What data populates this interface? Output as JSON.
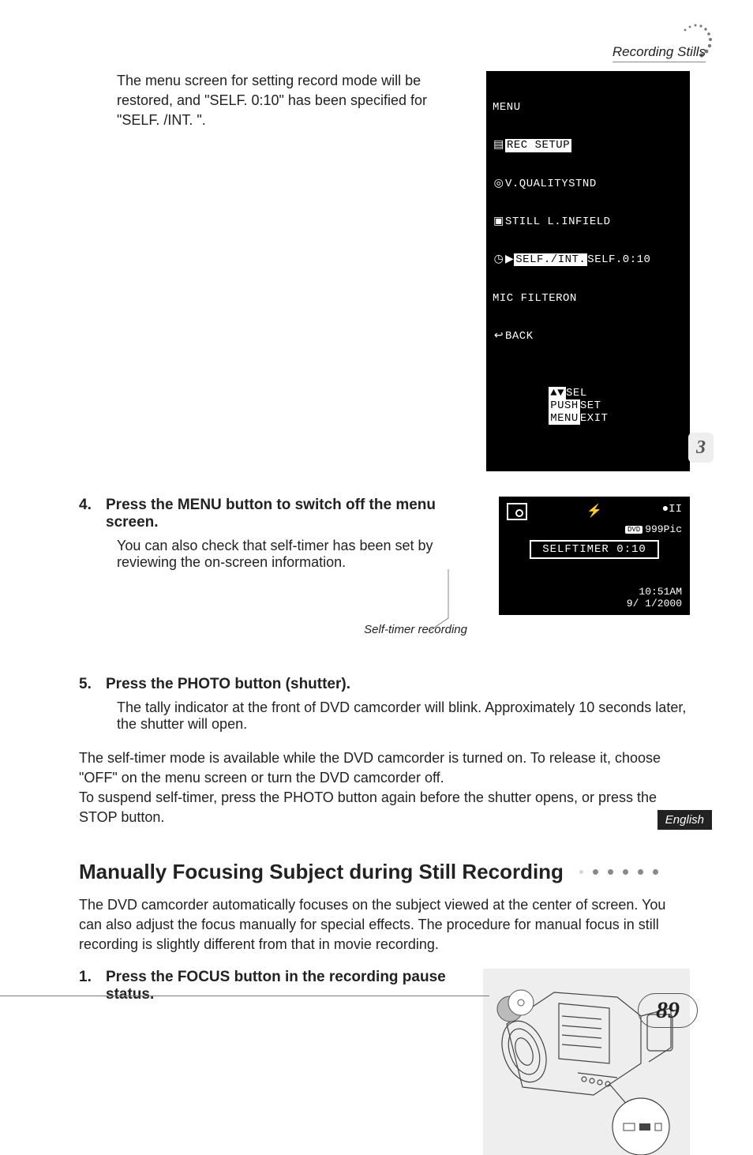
{
  "header": {
    "section_title": "Recording Stills"
  },
  "intro": {
    "text": "The menu screen for setting record mode will be restored, and \"SELF. 0:10\" has been specified for \"SELF. /INT. \"."
  },
  "menu_screen": {
    "title": "MENU",
    "group": "REC SETUP",
    "rows": [
      {
        "label": "V.QUALITY",
        "value": "STND"
      },
      {
        "label": "STILL L.IN",
        "value": "FIELD"
      },
      {
        "label": "SELF./INT.",
        "value": "SELF.0:10",
        "selected": true
      },
      {
        "label": "MIC FILTER",
        "value": "ON"
      }
    ],
    "back": "BACK",
    "footer": {
      "sel": "SEL",
      "push": "PUSH",
      "set": "SET",
      "menu": "MENU",
      "exit": "EXIT"
    }
  },
  "step4": {
    "num": "4.",
    "heading": "Press the MENU button to switch off the menu screen.",
    "body": "You can also check that self-timer has been set by reviewing the on-screen information.",
    "caption": "Self-timer recording"
  },
  "timer_screen": {
    "pic_label": "999Pic",
    "box": "SELFTIMER 0:10",
    "time": "10:51AM",
    "date": "9/ 1/2000",
    "pause": "●II"
  },
  "step5": {
    "num": "5.",
    "heading": "Press the PHOTO button (shutter).",
    "body": "The tally indicator at the front of DVD camcorder will blink. Approximately 10 seconds later, the shutter will open."
  },
  "release_text": "The self-timer mode is available while the DVD camcorder is turned on. To release it, choose \"OFF\" on the menu screen or turn the DVD camcorder off.\nTo suspend self-timer, press the PHOTO button again before the shutter opens, or press the STOP button.",
  "h2": "Manually Focusing Subject during Still Recording",
  "mf_intro": "The DVD camcorder automatically focuses on the subject viewed at the center of screen. You can also adjust the focus manually for special effects. The procedure for manual focus in still recording is slightly different from that in movie recording.",
  "step_focus": {
    "num": "1.",
    "heading": "Press the FOCUS button in the recording pause status."
  },
  "side": {
    "chapter": "3",
    "language": "English"
  },
  "page_number": "89"
}
